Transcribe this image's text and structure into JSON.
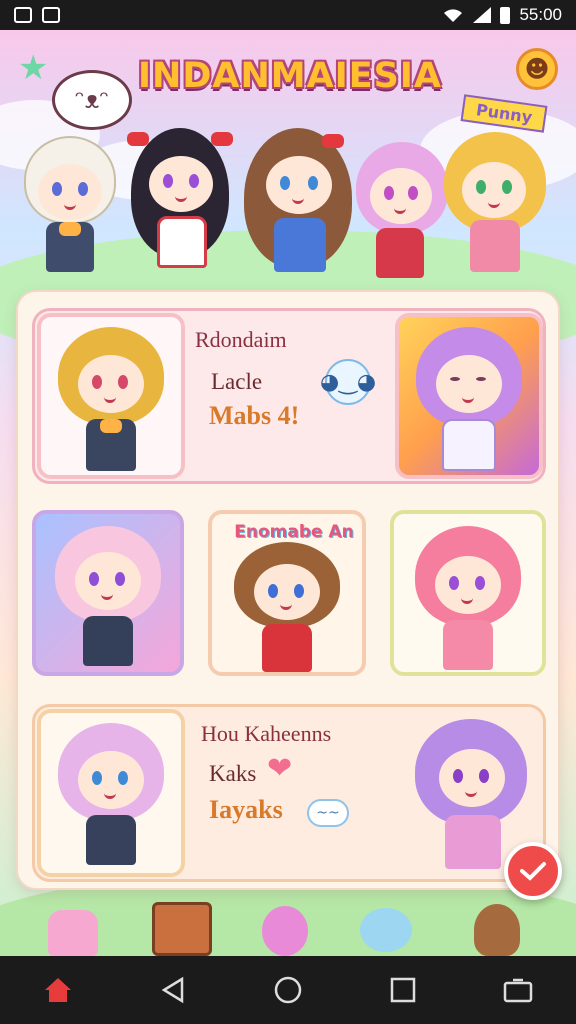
{
  "status_bar": {
    "time": "55:00"
  },
  "app": {
    "title": "INDANMAIESIA",
    "sticker_tag": "Punny",
    "chat_face": "ᵔᴥᵔ",
    "smile_face": "☻"
  },
  "cards": [
    {
      "title": "Rdondaim",
      "line1": "Lacle",
      "line2": "Mabs 4!",
      "badge_face": "◕‿◕"
    },
    {
      "title": "Hou Kaheenns",
      "line1": "Kaks",
      "line2": "Iayaks",
      "badge_text": "~~"
    }
  ],
  "middle_tile_title": "Enomabe An",
  "nav": {
    "home_icon": "home-icon",
    "back_icon": "back-triangle-icon",
    "home_circle_icon": "home-circle-icon",
    "recents_icon": "recents-square-icon",
    "apps_icon": "apps-icon"
  },
  "fab_icon": "check-icon"
}
